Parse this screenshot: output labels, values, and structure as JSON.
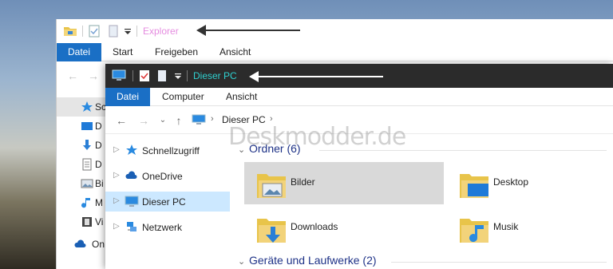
{
  "back_window": {
    "title": "Explorer",
    "ribbon_tabs": [
      "Datei",
      "Start",
      "Freigeben",
      "Ansicht"
    ],
    "sidebar_items": [
      "Schnellzugriff",
      "Desktop",
      "Downloads",
      "Dokumente",
      "Bilder",
      "Musik",
      "Videos",
      "OneDrive"
    ],
    "sidebar_partial_labels": [
      "Sch",
      "D",
      "D",
      "D",
      "Bi",
      "M",
      "Vi",
      "On"
    ]
  },
  "front_window": {
    "title": "Dieser PC",
    "ribbon_tabs": [
      "Datei",
      "Computer",
      "Ansicht"
    ],
    "address": {
      "crumb": "Dieser PC"
    },
    "sidebar": [
      {
        "label": "Schnellzugriff",
        "icon": "star-icon"
      },
      {
        "label": "OneDrive",
        "icon": "cloud-icon"
      },
      {
        "label": "Dieser PC",
        "icon": "pc-icon",
        "selected": true
      },
      {
        "label": "Netzwerk",
        "icon": "network-icon"
      }
    ],
    "groups": [
      {
        "label": "Ordner (6)"
      },
      {
        "label": "Geräte und Laufwerke (2)"
      }
    ],
    "folders": [
      {
        "label": "Bilder",
        "icon": "pictures-folder-icon",
        "selected": true
      },
      {
        "label": "Desktop",
        "icon": "desktop-folder-icon"
      },
      {
        "label": "Downloads",
        "icon": "downloads-folder-icon"
      },
      {
        "label": "Musik",
        "icon": "music-folder-icon"
      }
    ]
  },
  "watermark": "Deskmodder.de",
  "colors": {
    "file_tab": "#1a6fc5",
    "front_titlebar": "#2b2b2b",
    "front_title_text": "#2fd0d0",
    "back_title_text": "#e58ce0",
    "selection": "#cce8ff",
    "group_heading": "#1e3287"
  }
}
